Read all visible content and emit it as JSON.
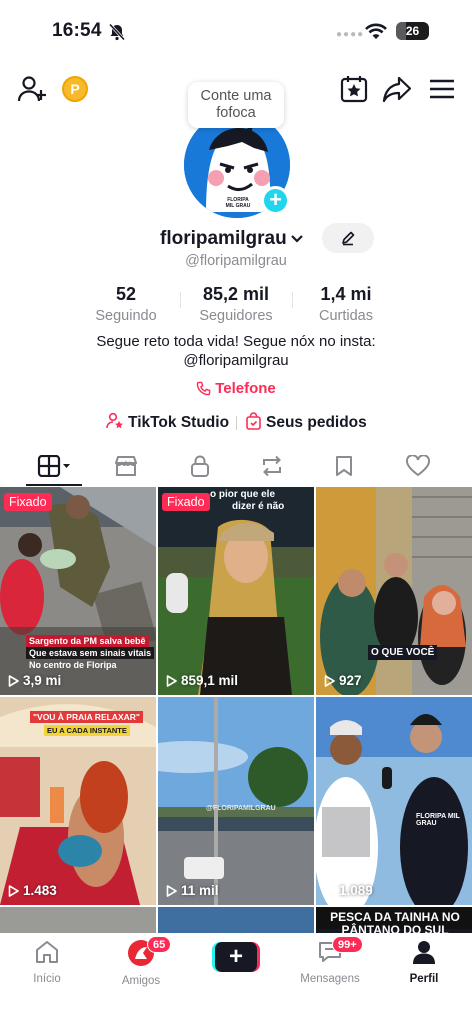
{
  "status_bar": {
    "time": "16:54",
    "battery": "26"
  },
  "header": {
    "coin_label": "P",
    "bubble_text": "Conte uma fofoca"
  },
  "profile": {
    "username": "floripamilgrau",
    "handle": "@floripamilgrau",
    "stats": [
      {
        "value": "52",
        "label": "Seguindo"
      },
      {
        "value": "85,2 mil",
        "label": "Seguidores"
      },
      {
        "value": "1,4 mi",
        "label": "Curtidas"
      }
    ],
    "bio_line1": "Segue reto toda vida! Segue nóx no insta:",
    "bio_line2": "@floripamilgrau",
    "phone_label": "Telefone",
    "studio_label": "TikTok Studio",
    "orders_label": "Seus pedidos"
  },
  "videos": [
    {
      "views": "3,9 mi",
      "pinned": "Fixado",
      "caption1": "Sargento da PM salva bebê",
      "caption2": "Que estava sem sinais vitais",
      "caption3": "No centro de Floripa"
    },
    {
      "views": "859,1 mil",
      "pinned": "Fixado",
      "caption1": "o pior que ele",
      "caption2": "dizer é não"
    },
    {
      "views": "927",
      "caption1": "O QUE VOCÊ"
    },
    {
      "views": "1.483",
      "caption1": "\"VOU À PRAIA RELAXAR\"",
      "caption2": "EU A CADA INSTANTE"
    },
    {
      "views": "11 mil",
      "caption1": "@FLORIPAMILGRAU"
    },
    {
      "views": "1.089",
      "caption1": "FLORIPA MIL GRAU"
    },
    {
      "caption1": "PESCA DA TAINHA NO",
      "caption2": "PÂNTANO DO SUL"
    }
  ],
  "nav": {
    "home": "Início",
    "friends": "Amigos",
    "friends_badge": "65",
    "create": "+",
    "messages": "Mensagens",
    "messages_badge": "99+",
    "profile": "Perfil"
  },
  "colors": {
    "accent": "#fe2c55",
    "cyan": "#25f4ee",
    "avatar_bg": "#1979d9"
  }
}
